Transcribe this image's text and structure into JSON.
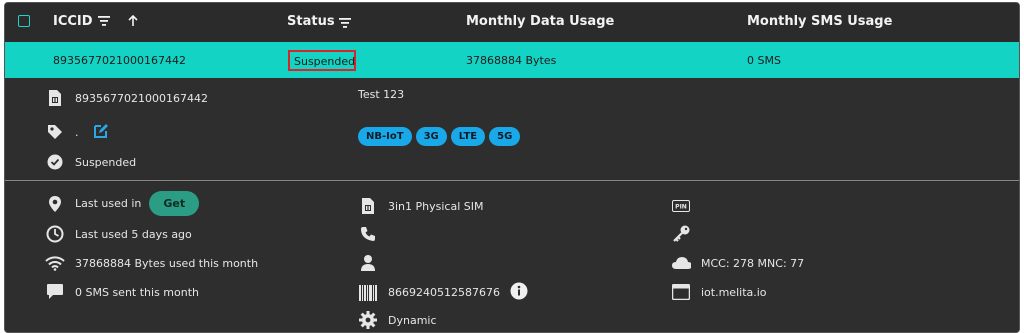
{
  "header": {
    "iccid_label": "ICCID",
    "status_label": "Status",
    "data_label": "Monthly Data Usage",
    "sms_label": "Monthly SMS Usage"
  },
  "selected_row": {
    "iccid": "8935677021000167442",
    "status": "Suspended",
    "data": "37868884 Bytes",
    "sms": "0 SMS"
  },
  "details": {
    "iccid": "8935677021000167442",
    "name": "Test 123",
    "tag": ".",
    "status": "Suspended",
    "networks": [
      "NB-IoT",
      "3G",
      "LTE",
      "5G"
    ]
  },
  "lower": {
    "last_used_in": "Last used in",
    "get_button": "Get",
    "last_used": "Last used 5 days ago",
    "bytes_used": "37868884 Bytes used this month",
    "sms_sent": "0 SMS sent this month",
    "sim_type": "3in1 Physical SIM",
    "imei": "8669240512587676",
    "ip_type": "Dynamic",
    "mcc_mnc": "MCC: 278 MNC: 77",
    "apn": "iot.melita.io",
    "pin_icon_text": "PIN"
  },
  "colors": {
    "accent": "#13d4c4",
    "pill": "#1aa9e8",
    "highlight": "#d6262a",
    "get": "#2a9d84"
  }
}
